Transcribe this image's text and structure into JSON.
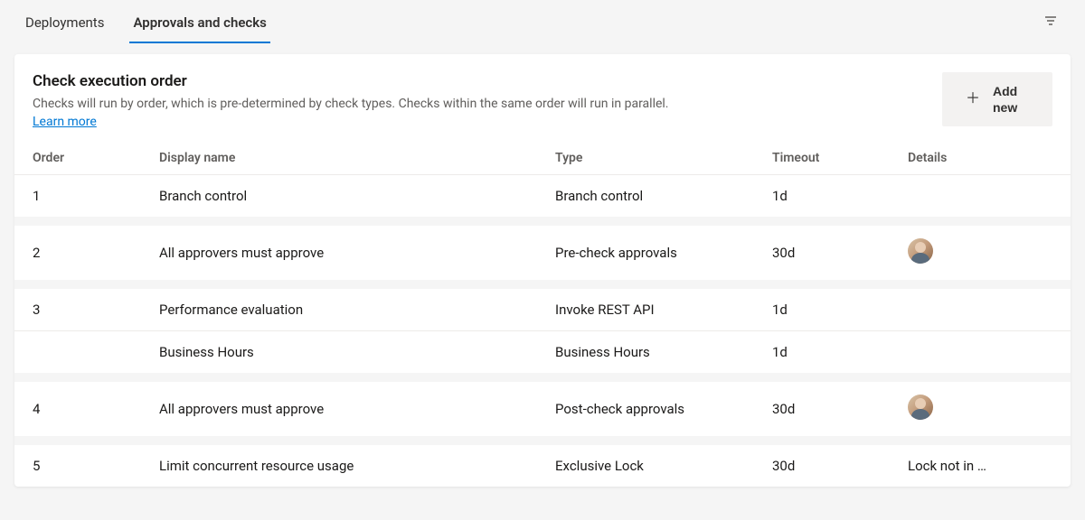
{
  "tabs": {
    "deployments": "Deployments",
    "approvals": "Approvals and checks"
  },
  "header": {
    "title": "Check execution order",
    "description": "Checks will run by order, which is pre-determined by check types. Checks within the same order will run in parallel.",
    "learn_more": "Learn more",
    "add_new": "Add new"
  },
  "columns": {
    "order": "Order",
    "display": "Display name",
    "type": "Type",
    "timeout": "Timeout",
    "details": "Details"
  },
  "groups": [
    {
      "rows": [
        {
          "order": "1",
          "display": "Branch control",
          "type": "Branch control",
          "timeout": "1d",
          "details": "",
          "avatar": false
        }
      ]
    },
    {
      "rows": [
        {
          "order": "2",
          "display": "All approvers must approve",
          "type": "Pre-check approvals",
          "timeout": "30d",
          "details": "",
          "avatar": true
        }
      ]
    },
    {
      "rows": [
        {
          "order": "3",
          "display": "Performance evaluation",
          "type": "Invoke REST API",
          "timeout": "1d",
          "details": "",
          "avatar": false
        },
        {
          "order": "",
          "display": "Business Hours",
          "type": "Business Hours",
          "timeout": "1d",
          "details": "",
          "avatar": false
        }
      ]
    },
    {
      "rows": [
        {
          "order": "4",
          "display": "All approvers must approve",
          "type": "Post-check approvals",
          "timeout": "30d",
          "details": "",
          "avatar": true
        }
      ]
    },
    {
      "rows": [
        {
          "order": "5",
          "display": "Limit concurrent resource usage",
          "type": "Exclusive Lock",
          "timeout": "30d",
          "details": "Lock not in …",
          "avatar": false
        }
      ]
    }
  ]
}
